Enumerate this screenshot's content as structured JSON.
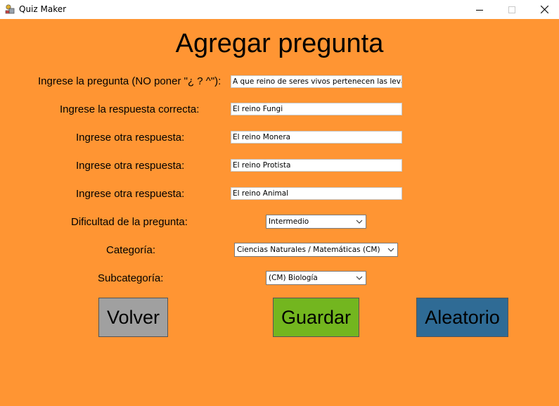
{
  "window": {
    "title": "Quiz Maker",
    "icons": {
      "app": "quiz-maker-app-icon",
      "minimize": "minimize-icon",
      "maximize": "maximize-icon",
      "close": "close-icon"
    }
  },
  "colors": {
    "background": "#ff9533",
    "volver": "#a0a0a0",
    "guardar": "#73b61f",
    "aleatorio": "#2f6b95"
  },
  "form": {
    "heading": "Agregar pregunta",
    "question_label": "Ingrese la pregunta (NO poner \"¿ ? ^\"):",
    "question_value": "A que reino de seres vivos pertenecen las levaduras",
    "correct_label": "Ingrese la respuesta correcta:",
    "correct_value": "El reino Fungi",
    "other1_label": "Ingrese otra respuesta:",
    "other1_value": "El reino Monera",
    "other2_label": "Ingrese otra respuesta:",
    "other2_value": "El reino Protista",
    "other3_label": "Ingrese otra respuesta:",
    "other3_value": "El reino Animal",
    "difficulty_label": "Dificultad de la pregunta:",
    "difficulty_value": "Intermedio",
    "category_label": "Categoría:",
    "category_value": "Ciencias Naturales / Matemáticas (CM)",
    "subcategory_label": "Subcategoría:",
    "subcategory_value": "(CM) Biología"
  },
  "buttons": {
    "volver": "Volver",
    "guardar": "Guardar",
    "aleatorio": "Aleatorio"
  }
}
